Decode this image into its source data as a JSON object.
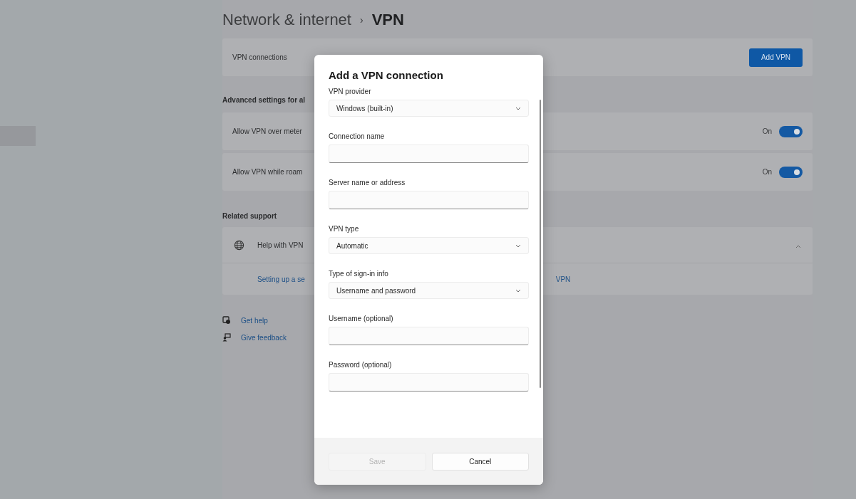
{
  "breadcrumb": {
    "parent": "Network & internet",
    "separator": "›",
    "current": "VPN"
  },
  "vpn_connections": {
    "label": "VPN connections",
    "button": "Add VPN"
  },
  "advanced_heading": "Advanced settings for al",
  "toggles": [
    {
      "label": "Allow VPN over meter",
      "status": "On",
      "on": true
    },
    {
      "label": "Allow VPN while roam",
      "status": "On",
      "on": true
    }
  ],
  "related_heading": "Related support",
  "help": {
    "title": "Help with VPN",
    "expanded": true,
    "link": "Setting up a se",
    "link_tail": "VPN"
  },
  "footer_links": [
    {
      "kind": "help",
      "label": "Get help"
    },
    {
      "kind": "feedback",
      "label": "Give feedback"
    }
  ],
  "dialog": {
    "title": "Add a VPN connection",
    "fields": [
      {
        "kind": "dropdown",
        "label": "VPN provider",
        "value": "Windows (built-in)"
      },
      {
        "kind": "text",
        "label": "Connection name"
      },
      {
        "kind": "text",
        "label": "Server name or address"
      },
      {
        "kind": "dropdown",
        "label": "VPN type",
        "value": "Automatic"
      },
      {
        "kind": "dropdown",
        "label": "Type of sign-in info",
        "value": "Username and password"
      },
      {
        "kind": "text",
        "label": "Username (optional)"
      },
      {
        "kind": "text",
        "label": "Password (optional)"
      }
    ],
    "buttons": [
      {
        "label": "Save",
        "disabled": true
      },
      {
        "label": "Cancel",
        "disabled": false
      }
    ]
  }
}
